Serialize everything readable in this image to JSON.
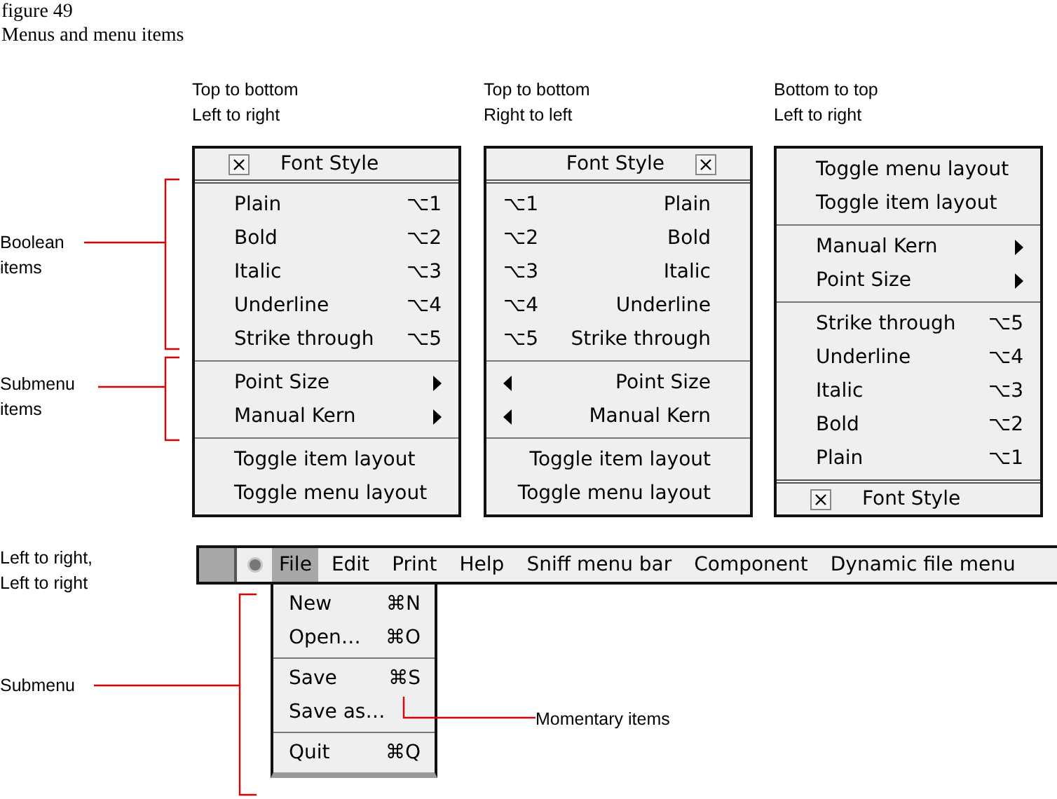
{
  "figure": {
    "number": "figure 49",
    "caption": "Menus and menu items"
  },
  "menus": [
    {
      "kind": "ltr",
      "caption": [
        "Top to bottom",
        "Left to right"
      ],
      "title": "Font Style",
      "groups": [
        [
          {
            "kind": "toggle",
            "label": "Plain",
            "shortcut": "⌥1"
          },
          {
            "kind": "toggle",
            "label": "Bold",
            "shortcut": "⌥2"
          },
          {
            "kind": "toggle",
            "label": "Italic",
            "shortcut": "⌥3"
          },
          {
            "kind": "toggle",
            "label": "Underline",
            "shortcut": "⌥4"
          },
          {
            "kind": "toggle",
            "label": "Strike through",
            "shortcut": "⌥5"
          }
        ],
        [
          {
            "kind": "submenu",
            "label": "Point Size"
          },
          {
            "kind": "submenu",
            "label": "Manual Kern"
          }
        ],
        [
          {
            "kind": "command",
            "label": "Toggle item layout"
          },
          {
            "kind": "command",
            "label": "Toggle menu layout"
          }
        ]
      ]
    },
    {
      "kind": "rtl",
      "caption": [
        "Top to bottom",
        "Right to left"
      ],
      "title": "Font Style",
      "groups": [
        [
          {
            "kind": "toggle",
            "label": "Plain",
            "shortcut": "⌥1"
          },
          {
            "kind": "toggle",
            "label": "Bold",
            "shortcut": "⌥2"
          },
          {
            "kind": "toggle",
            "label": "Italic",
            "shortcut": "⌥3"
          },
          {
            "kind": "toggle",
            "label": "Underline",
            "shortcut": "⌥4"
          },
          {
            "kind": "toggle",
            "label": "Strike through",
            "shortcut": "⌥5"
          }
        ],
        [
          {
            "kind": "submenu",
            "label": "Point Size"
          },
          {
            "kind": "submenu",
            "label": "Manual Kern"
          }
        ],
        [
          {
            "kind": "command",
            "label": "Toggle item layout"
          },
          {
            "kind": "command",
            "label": "Toggle menu layout"
          }
        ]
      ]
    },
    {
      "kind": "btt",
      "caption": [
        "Bottom to top",
        "Left to right"
      ],
      "title": "Font Style",
      "groups": [
        [
          {
            "kind": "command",
            "label": "Toggle menu layout"
          },
          {
            "kind": "command",
            "label": "Toggle item layout"
          }
        ],
        [
          {
            "kind": "submenu",
            "label": "Manual Kern"
          },
          {
            "kind": "submenu",
            "label": "Point Size"
          }
        ],
        [
          {
            "kind": "toggle",
            "label": "Strike through",
            "shortcut": "⌥5"
          },
          {
            "kind": "toggle",
            "label": "Underline",
            "shortcut": "⌥4"
          },
          {
            "kind": "toggle",
            "label": "Italic",
            "shortcut": "⌥3"
          },
          {
            "kind": "toggle",
            "label": "Bold",
            "shortcut": "⌥2"
          },
          {
            "kind": "toggle",
            "label": "Plain",
            "shortcut": "⌥1"
          }
        ]
      ]
    }
  ],
  "menu_bar": {
    "caption": [
      "Left to right,",
      "Left to right"
    ],
    "items": [
      {
        "label": "File",
        "selected": true
      },
      {
        "label": "Edit",
        "selected": false
      },
      {
        "label": "Print",
        "selected": false
      },
      {
        "label": "Help",
        "selected": false
      },
      {
        "label": "Sniff menu bar",
        "selected": false
      },
      {
        "label": "Component",
        "selected": false
      },
      {
        "label": "Dynamic file menu",
        "selected": false
      }
    ],
    "dropdown": {
      "groups": [
        [
          {
            "label": "New",
            "shortcut": "⌘N"
          },
          {
            "label": "Open…",
            "shortcut": "⌘O"
          }
        ],
        [
          {
            "label": "Save",
            "shortcut": "⌘S"
          },
          {
            "label": "Save as…"
          }
        ],
        [
          {
            "label": "Quit",
            "shortcut": "⌘Q"
          }
        ]
      ]
    }
  },
  "annotations": [
    {
      "lines": [
        "Boolean",
        "items"
      ]
    },
    {
      "lines": [
        "Submenu",
        "items"
      ]
    },
    {
      "lines": [
        "Submenu"
      ]
    },
    {
      "lines": [
        "Momentary items"
      ]
    }
  ]
}
